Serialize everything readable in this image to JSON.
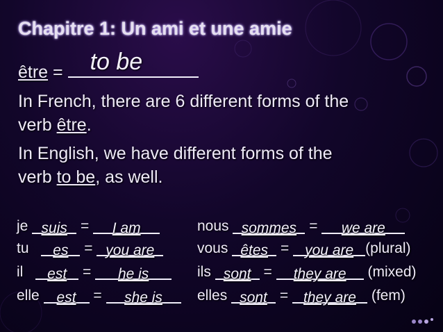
{
  "slide": {
    "title": "Chapitre 1: Un ami et une amie",
    "definition": {
      "word": "être",
      "equals": " = ",
      "answer": "to be"
    },
    "intro": [
      {
        "text": "In French, there are 6 different forms of the"
      },
      {
        "pre": "verb ",
        "verb": "être",
        "post": "."
      },
      {
        "text": "In English, we have different forms of the"
      },
      {
        "pre": "verb  ",
        "verb": "to be",
        "post": ",  as well."
      }
    ],
    "singular": [
      {
        "pronoun": "je",
        "french": "suis",
        "english": "I am",
        "note": ""
      },
      {
        "pronoun": "tu",
        "french": "es",
        "english": "you are",
        "note": ""
      },
      {
        "pronoun": "il",
        "french": "est",
        "english": "he is",
        "note": ""
      },
      {
        "pronoun": "elle",
        "french": "est",
        "english": "she is",
        "note": ""
      }
    ],
    "plural": [
      {
        "pronoun": "nous",
        "french": "sommes",
        "english": "we are",
        "note": ""
      },
      {
        "pronoun": "vous",
        "french": "êtes",
        "english": "you are",
        "note": "(plural)"
      },
      {
        "pronoun": "ils",
        "french": "sont",
        "english": "they are",
        "note": "(mixed)"
      },
      {
        "pronoun": "elles",
        "french": "sont",
        "english": "they are",
        "note": "(fem)"
      }
    ],
    "equals_sign": "="
  }
}
